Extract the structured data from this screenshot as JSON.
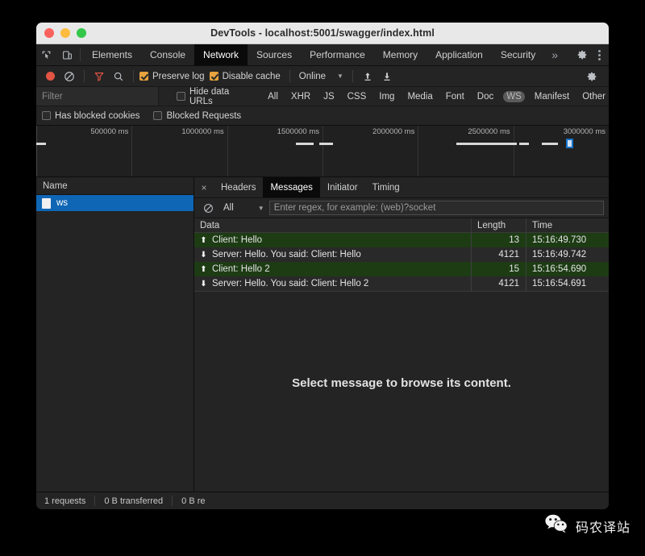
{
  "window": {
    "title": "DevTools - localhost:5001/swagger/index.html",
    "traffic_lights": [
      "close",
      "minimize",
      "maximize"
    ]
  },
  "devtools_tabs": {
    "icons": [
      "inspect-element-icon",
      "device-toolbar-icon"
    ],
    "items": [
      {
        "label": "Elements",
        "active": false
      },
      {
        "label": "Console",
        "active": false
      },
      {
        "label": "Network",
        "active": true
      },
      {
        "label": "Sources",
        "active": false
      },
      {
        "label": "Performance",
        "active": false
      },
      {
        "label": "Memory",
        "active": false
      },
      {
        "label": "Application",
        "active": false
      },
      {
        "label": "Security",
        "active": false
      }
    ],
    "overflow_label": "»",
    "settings_icon": "gear-icon",
    "menu_icon": "kebab-menu-icon"
  },
  "network_toolbar": {
    "record_title": "record-button",
    "clear_title": "clear-button",
    "filter_title": "filter-button",
    "search_title": "search-button",
    "preserve_log": {
      "label": "Preserve log",
      "checked": true
    },
    "disable_cache": {
      "label": "Disable cache",
      "checked": true
    },
    "throttle": {
      "value": "Online",
      "caret": "▼"
    },
    "import_icon": "import-har-icon",
    "export_icon": "export-har-icon",
    "settings_icon": "gear-icon"
  },
  "filter_bar": {
    "filter_placeholder": "Filter",
    "filter_value": "",
    "hide_data_urls": {
      "label": "Hide data URLs",
      "checked": false
    },
    "types": [
      {
        "label": "All",
        "selected": false
      },
      {
        "label": "XHR",
        "selected": false
      },
      {
        "label": "JS",
        "selected": false
      },
      {
        "label": "CSS",
        "selected": false
      },
      {
        "label": "Img",
        "selected": false
      },
      {
        "label": "Media",
        "selected": false
      },
      {
        "label": "Font",
        "selected": false
      },
      {
        "label": "Doc",
        "selected": false
      },
      {
        "label": "WS",
        "selected": true
      },
      {
        "label": "Manifest",
        "selected": false
      },
      {
        "label": "Other",
        "selected": false
      }
    ],
    "has_blocked_cookies": {
      "label": "Has blocked cookies",
      "checked": false
    },
    "blocked_requests": {
      "label": "Blocked Requests",
      "checked": false
    }
  },
  "overview": {
    "ticks": [
      {
        "label": "500000 ms",
        "pct": 16.666
      },
      {
        "label": "1000000 ms",
        "pct": 33.333
      },
      {
        "label": "1500000 ms",
        "pct": 50.0
      },
      {
        "label": "2000000 ms",
        "pct": 66.666
      },
      {
        "label": "2500000 ms",
        "pct": 83.333
      },
      {
        "label": "3000000 ms",
        "pct": 100.0
      }
    ],
    "bars": [
      {
        "left_pct": 0.0,
        "width_pct": 1.7
      },
      {
        "left_pct": 45.3,
        "width_pct": 3.1
      },
      {
        "left_pct": 49.5,
        "width_pct": 2.3
      },
      {
        "left_pct": 73.4,
        "width_pct": 10.5
      },
      {
        "left_pct": 84.4,
        "width_pct": 1.6
      },
      {
        "left_pct": 88.3,
        "width_pct": 2.8
      }
    ],
    "marker_pct": 92.6
  },
  "requests_panel": {
    "column_header": "Name",
    "rows": [
      {
        "name": "ws",
        "icon": "websocket-document-icon",
        "selected": true
      }
    ]
  },
  "detail_panel": {
    "close_label": "×",
    "tabs": [
      {
        "label": "Headers",
        "active": false
      },
      {
        "label": "Messages",
        "active": true
      },
      {
        "label": "Initiator",
        "active": false
      },
      {
        "label": "Timing",
        "active": false
      }
    ],
    "message_filter": {
      "clear_icon": "clear-messages-icon",
      "type_value": "All",
      "caret": "▼",
      "regex_placeholder": "Enter regex, for example: (web)?socket",
      "regex_value": ""
    },
    "table": {
      "columns": [
        "Data",
        "Length",
        "Time"
      ],
      "rows": [
        {
          "direction": "sent",
          "arrow": "⬆",
          "data": "Client: Hello",
          "length": "13",
          "time": "15:16:49.730"
        },
        {
          "direction": "received",
          "arrow": "⬇",
          "data": "Server: Hello. You said: Client: Hello",
          "length": "4121",
          "time": "15:16:49.742"
        },
        {
          "direction": "sent",
          "arrow": "⬆",
          "data": "Client: Hello 2",
          "length": "15",
          "time": "15:16:54.690"
        },
        {
          "direction": "received",
          "arrow": "⬇",
          "data": "Server: Hello. You said: Client: Hello 2",
          "length": "4121",
          "time": "15:16:54.691"
        }
      ]
    },
    "empty_state": "Select message to browse its content."
  },
  "status_bar": {
    "items": [
      "1 requests",
      "0 B transferred",
      "0 B re"
    ]
  },
  "watermark": {
    "logo": "wechat-icon",
    "text": "码农译站"
  },
  "colors": {
    "accent_blue": "#0f66b5",
    "sent_row_green": "#1d3c14",
    "record_red": "#e25443",
    "checkbox_orange": "#e8a33d",
    "panel_bg": "#242424"
  }
}
